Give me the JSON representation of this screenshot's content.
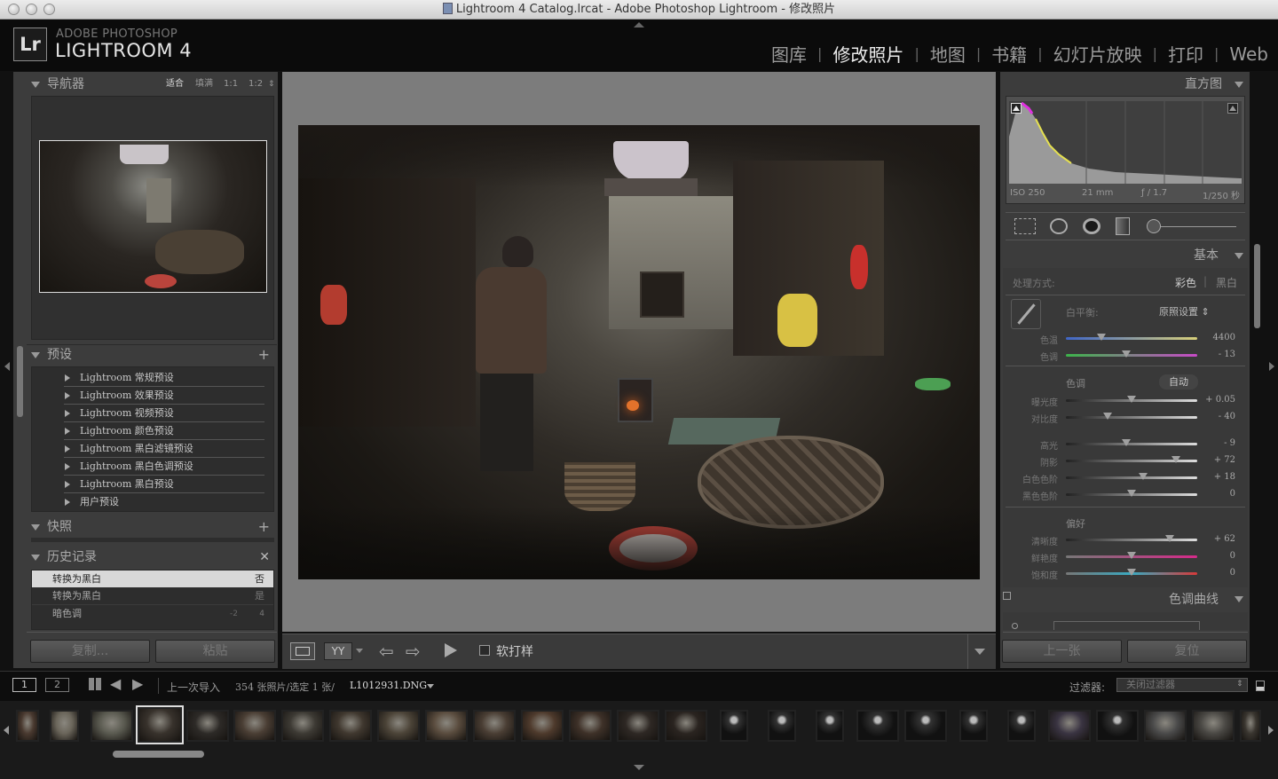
{
  "window": {
    "title": "Lightroom 4 Catalog.lrcat - Adobe Photoshop Lightroom - 修改照片"
  },
  "brand": {
    "logo": "Lr",
    "line1": "ADOBE PHOTOSHOP",
    "line2": "LIGHTROOM 4"
  },
  "modules": [
    "图库",
    "修改照片",
    "地图",
    "书籍",
    "幻灯片放映",
    "打印",
    "Web"
  ],
  "navigator": {
    "title": "导航器",
    "zoom": [
      "适合",
      "填满",
      "1:1",
      "1:2"
    ]
  },
  "presets": {
    "title": "预设",
    "items": [
      "Lightroom 常规预设",
      "Lightroom 效果预设",
      "Lightroom 视频预设",
      "Lightroom 颜色预设",
      "Lightroom 黑白滤镜预设",
      "Lightroom 黑白色调预设",
      "Lightroom 黑白预设",
      "用户预设"
    ]
  },
  "snapshots": {
    "title": "快照"
  },
  "history": {
    "title": "历史记录",
    "rows": [
      {
        "label": "转换为黑白",
        "a": "",
        "b": "否"
      },
      {
        "label": "转换为黑白",
        "a": "",
        "b": "是"
      },
      {
        "label": "暗色调",
        "a": "-2",
        "b": "4"
      }
    ]
  },
  "left_buttons": {
    "copy": "复制...",
    "paste": "粘贴"
  },
  "toolbar": {
    "softproof": "软打样",
    "view_mode": "YY"
  },
  "histogram": {
    "title": "直方图",
    "iso": "ISO 250",
    "focal": "21 mm",
    "aperture": "ƒ / 1.7",
    "shutter": "1/250 秒"
  },
  "basic": {
    "title": "基本",
    "treatment_label": "处理方式:",
    "treatment_color": "彩色",
    "treatment_bw": "黑白",
    "wb_label": "白平衡:",
    "wb_value": "原照设置 ⇕",
    "tone_label": "色调",
    "auto": "自动",
    "presence_label": "偏好",
    "sliders": [
      {
        "label": "色温",
        "value": "4400",
        "pos": 0.27
      },
      {
        "label": "色调",
        "value": "- 13",
        "pos": 0.46
      },
      {
        "label": "曝光度",
        "value": "+ 0.05",
        "pos": 0.5
      },
      {
        "label": "对比度",
        "value": "- 40",
        "pos": 0.32
      },
      {
        "label": "高光",
        "value": "- 9",
        "pos": 0.46
      },
      {
        "label": "阴影",
        "value": "+ 72",
        "pos": 0.84
      },
      {
        "label": "白色色阶",
        "value": "+ 18",
        "pos": 0.59
      },
      {
        "label": "黑色色阶",
        "value": "0",
        "pos": 0.5
      },
      {
        "label": "清晰度",
        "value": "+ 62",
        "pos": 0.79
      },
      {
        "label": "鲜艳度",
        "value": "0",
        "pos": 0.5
      },
      {
        "label": "饱和度",
        "value": "0",
        "pos": 0.5
      }
    ]
  },
  "tone_curve": {
    "title": "色调曲线"
  },
  "right_buttons": {
    "prev": "上一张",
    "reset": "复位"
  },
  "filmstrip_bar": {
    "screen1": "1",
    "screen2": "2",
    "source": "上一次导入",
    "info": "354 张照片/选定 1 张/",
    "filename": "L1012931.DNG",
    "filter_label": "过滤器:",
    "filter_value": "关闭过滤器"
  },
  "colors": {
    "panel": "#3c3c3c",
    "background": "#111111",
    "selected_history": "#d8d8d8"
  }
}
